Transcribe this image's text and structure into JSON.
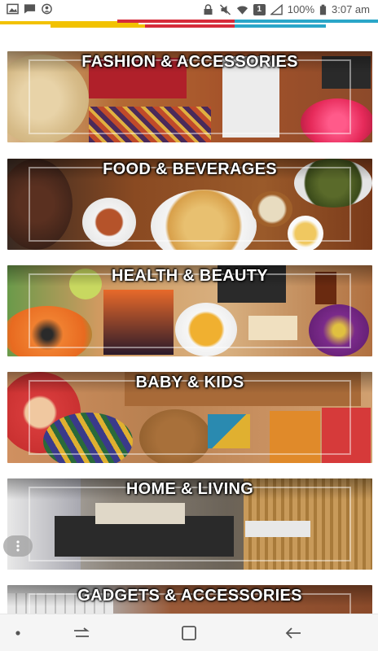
{
  "status_bar": {
    "battery_text": "100%",
    "time": "3:07 am",
    "left_icons": [
      "image-icon",
      "message-icon",
      "account-circle-icon"
    ],
    "right_icons": [
      "lock-icon",
      "mute-icon",
      "wifi-icon",
      "sim-icon",
      "signal-icon",
      "battery-icon"
    ],
    "sim_badge": "1"
  },
  "brand_stripe": {
    "colors": [
      "#f2c200",
      "#d62b3a",
      "#2aa6c8"
    ]
  },
  "categories": [
    {
      "label": "FASHION & ACCESSORIES",
      "theme": "#b8733a"
    },
    {
      "label": "FOOD & BEVERAGES",
      "theme": "#8a4a22"
    },
    {
      "label": "HEALTH & BEAUTY",
      "theme": "#cf9a5e"
    },
    {
      "label": "BABY & KIDS",
      "theme": "#c08850"
    },
    {
      "label": "HOME & LIVING",
      "theme": "#6b6358"
    },
    {
      "label": "GADGETS & ACCESSORIES",
      "theme": "#9a5a38"
    }
  ],
  "nav_bar": {
    "buttons": [
      "dot-icon",
      "recents-icon",
      "home-square-icon",
      "back-arrow-icon"
    ]
  }
}
